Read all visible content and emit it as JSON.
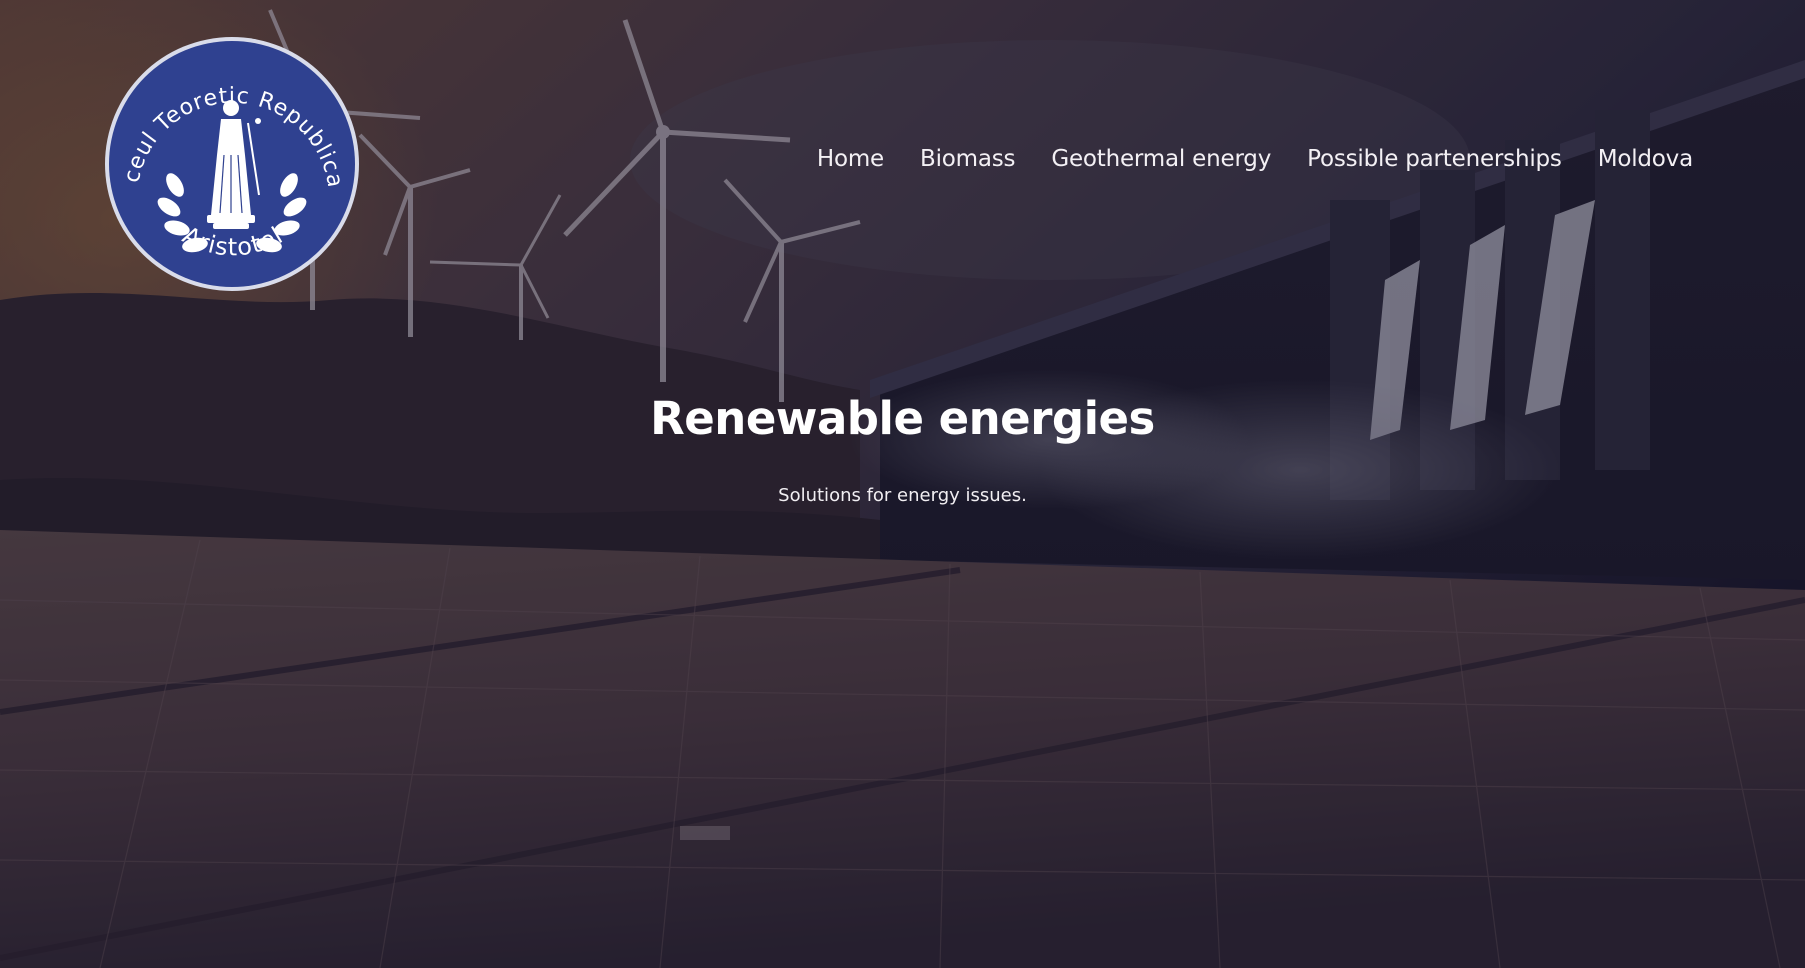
{
  "logo": {
    "top_text": "Liceul Teoretic Republican",
    "bottom_text": "Aristotel",
    "colors": {
      "badge": "#2f4190",
      "ring": "#d9dcea",
      "text": "#ffffff"
    }
  },
  "nav": {
    "items": [
      {
        "label": "Home"
      },
      {
        "label": "Biomass"
      },
      {
        "label": "Geothermal energy"
      },
      {
        "label": "Possible partenerships"
      },
      {
        "label": "Moldova"
      }
    ]
  },
  "hero": {
    "title": "Renewable energies",
    "subtitle": "Solutions for energy issues.",
    "background": "wind turbines, hydroelectric dam and solar panels under a dark purple overlay"
  }
}
